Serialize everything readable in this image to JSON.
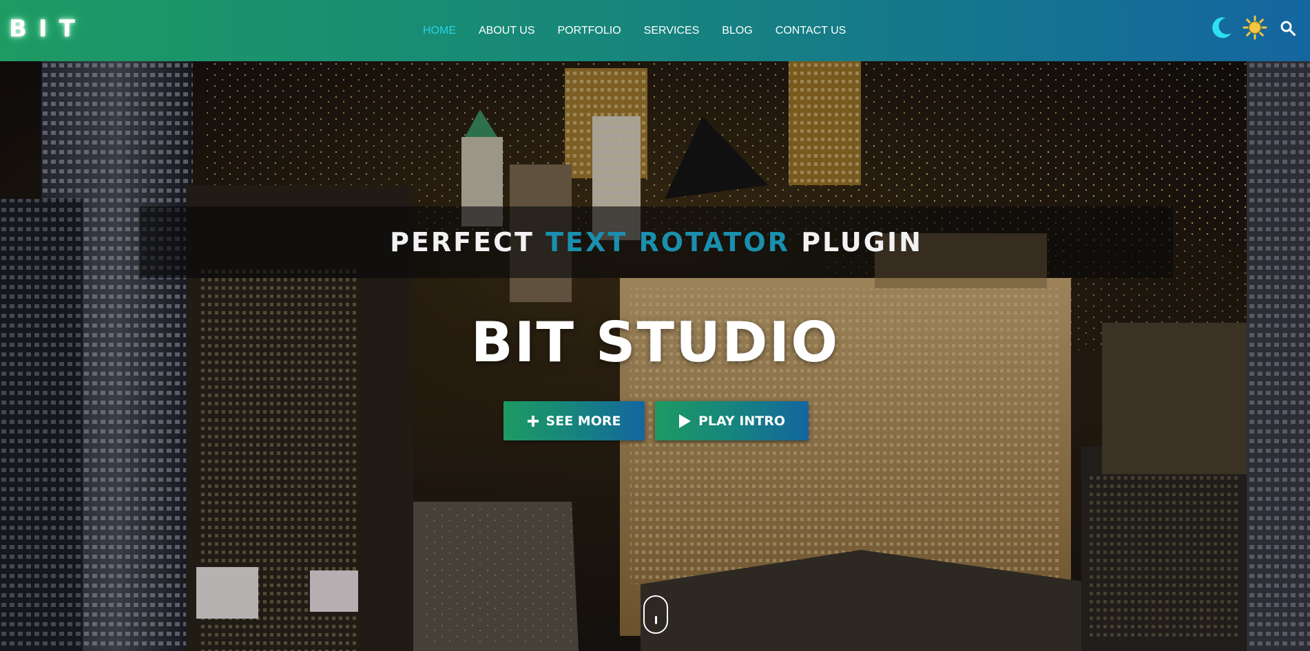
{
  "header": {
    "logo": "BIT",
    "nav": [
      {
        "label": "HOME",
        "active": true
      },
      {
        "label": "ABOUT US",
        "active": false
      },
      {
        "label": "PORTFOLIO",
        "active": false
      },
      {
        "label": "SERVICES",
        "active": false
      },
      {
        "label": "BLOG",
        "active": false
      },
      {
        "label": "CONTACT US",
        "active": false
      }
    ],
    "icons": [
      "moon-icon",
      "sun-icon",
      "search-icon"
    ],
    "gradient": [
      "#1e9a63",
      "#17877a",
      "#1466a0"
    ],
    "active_color": "#27d3e6"
  },
  "hero": {
    "rotator": {
      "prefix": "PERFECT",
      "highlight": "TEXT ROTATOR",
      "suffix": "PLUGIN",
      "highlight_color": "#1a8fae"
    },
    "title": "BIT STUDIO",
    "buttons": {
      "see_more": "SEE MORE",
      "play_intro": "PLAY INTRO"
    },
    "background": "night city skyline (aerial)",
    "scroll_indicator_icon": "mouse-scroll-icon"
  }
}
